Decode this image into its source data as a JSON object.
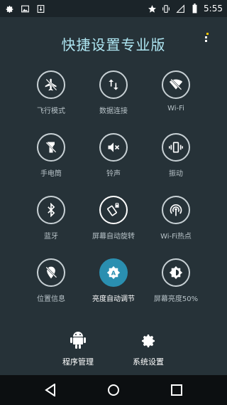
{
  "status_bar": {
    "time": "5:55",
    "icons": [
      "gear-icon",
      "image-icon",
      "download-icon",
      "star-icon",
      "vibrate-icon",
      "signal-icon",
      "battery-icon"
    ]
  },
  "title": "快捷设置专业版",
  "tiles": [
    {
      "label": "飞行模式",
      "icon": "airplane-off-icon",
      "active": false
    },
    {
      "label": "数据连接",
      "icon": "data-arrows-icon",
      "active": false
    },
    {
      "label": "Wi-Fi",
      "icon": "wifi-off-icon",
      "active": false
    },
    {
      "label": "手电筒",
      "icon": "flashlight-off-icon",
      "active": false
    },
    {
      "label": "铃声",
      "icon": "volume-off-icon",
      "active": false
    },
    {
      "label": "振动",
      "icon": "vibrate-icon",
      "active": false
    },
    {
      "label": "蓝牙",
      "icon": "bluetooth-icon",
      "active": false
    },
    {
      "label": "屏幕自动旋转",
      "icon": "screen-rotation-icon",
      "active": false
    },
    {
      "label": "Wi-Fi热点",
      "icon": "hotspot-icon",
      "active": false
    },
    {
      "label": "位置信息",
      "icon": "location-off-icon",
      "active": false
    },
    {
      "label": "亮度自动调节",
      "icon": "brightness-auto-icon",
      "active": true
    },
    {
      "label": "屏幕亮度50%",
      "icon": "brightness-half-icon",
      "active": false
    }
  ],
  "bottom": [
    {
      "label": "程序管理",
      "icon": "android-icon"
    },
    {
      "label": "系统设置",
      "icon": "settings-gear-icon"
    }
  ],
  "colors": {
    "accent": "#2a8fb0",
    "background": "#263238",
    "title": "#aee6f2"
  }
}
